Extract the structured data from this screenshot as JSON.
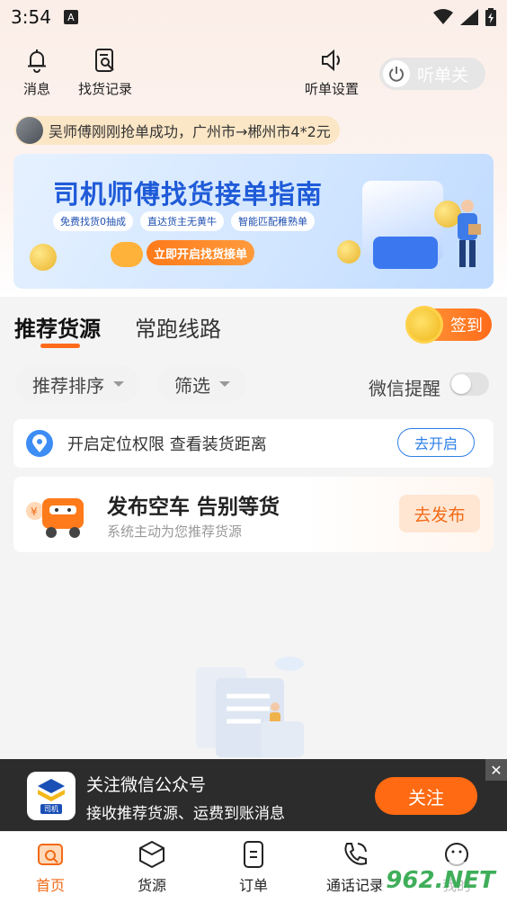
{
  "status_bar": {
    "time": "3:54",
    "a_icon": "A"
  },
  "toolbar": {
    "messages_label": "消息",
    "find_record_label": "找货记录",
    "listen_settings_label": "听单设置",
    "listen_toggle_label": "听单关"
  },
  "notice": {
    "text": "吴师傅刚刚抢单成功，广州市→郴州市4*2元"
  },
  "banner": {
    "title": "司机师傅找货接单指南",
    "features": [
      "免费找货0抽成",
      "直达货主无黄牛",
      "智能匹配稚熟单"
    ],
    "button": "立即开启找货接单"
  },
  "tabs": {
    "recommended": "推荐货源",
    "routes": "常跑线路",
    "signin": "签到"
  },
  "filters": {
    "sort": "推荐排序",
    "filter": "筛选",
    "wechat_remind": "微信提醒",
    "wechat_remind_on": false
  },
  "location_card": {
    "text": "开启定位权限 查看装货距离",
    "button": "去开启"
  },
  "publish_card": {
    "title": "发布空车 告别等货",
    "subtitle": "系统主动为您推荐货源",
    "button": "去发布"
  },
  "wechat_bar": {
    "title": "关注微信公众号",
    "subtitle": "接收推荐货源、运费到账消息",
    "button": "关注",
    "close": "✕",
    "logo_text": "司机"
  },
  "nav": {
    "items": [
      {
        "label": "首页",
        "icon": "home-search-icon",
        "active": true
      },
      {
        "label": "货源",
        "icon": "box-icon",
        "active": false
      },
      {
        "label": "订单",
        "icon": "order-icon",
        "active": false
      },
      {
        "label": "通话记录",
        "icon": "phone-icon",
        "active": false
      },
      {
        "label": "我的",
        "icon": "smile-icon",
        "active": false
      }
    ]
  },
  "watermark": "962.NET",
  "colors": {
    "accent": "#ff6b1a",
    "blue": "#2d7fe8",
    "banner_blue": "#1f5bd8"
  }
}
